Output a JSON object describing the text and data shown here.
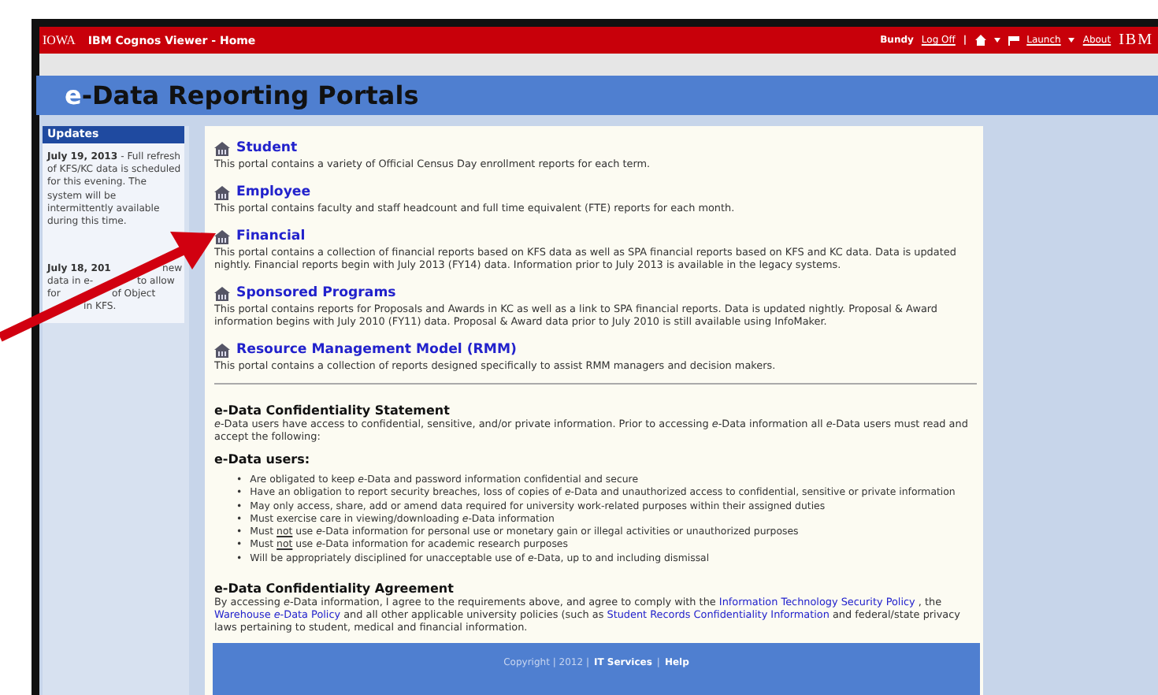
{
  "header": {
    "logo": "IOWA",
    "title": "IBM Cognos Viewer - Home",
    "user": "Bundy",
    "log_off": "Log Off",
    "separator": "|",
    "launch": "Launch",
    "about": "About",
    "brand": "IBM"
  },
  "page_title": {
    "prefix": "e",
    "text": "-Data Reporting Portals"
  },
  "updates": {
    "title": "Updates",
    "notes": [
      {
        "kind": "full",
        "date": "July 19, 2013",
        "text": " - Full refresh of KFS/KC data is scheduled for this evening. The system will be intermittently available during this time."
      },
      {
        "kind": "fragments",
        "lines": [
          [
            "July 18, 201",
            "new"
          ],
          [
            "data in e-",
            "to allow"
          ],
          [
            "for",
            "of Object"
          ],
          [
            "in KFS."
          ]
        ]
      }
    ]
  },
  "portals": [
    {
      "title": "Student",
      "description": "This portal contains a variety of Official Census Day enrollment reports for each term."
    },
    {
      "title": "Employee",
      "description": "This portal contains faculty and staff headcount and full time equivalent (FTE) reports for each month."
    },
    {
      "title": "Financial",
      "description": "This portal contains a collection of financial reports based on KFS data as well as SPA financial reports based on KFS and KC data. Data is updated nightly. Financial reports begin with July 2013 (FY14) data. Information prior to July 2013 is available in the legacy systems."
    },
    {
      "title": "Sponsored Programs",
      "description": "This portal contains reports for Proposals and Awards in KC as well as a link to SPA financial reports. Data is updated nightly. Proposal & Award information begins with July 2010 (FY11) data. Proposal & Award data prior to July 2010 is still available using InfoMaker."
    },
    {
      "title": "Resource Management Model (RMM)",
      "description": "This portal contains a collection of reports designed specifically to assist RMM managers and decision makers."
    }
  ],
  "statement": {
    "title": "e-Data Confidentiality Statement",
    "text": "*e*-Data users have access to confidential, sensitive, and/or private information. Prior to accessing *e*-Data information all *e*-Data users must read and accept the following:"
  },
  "users": {
    "title": "e-Data users:",
    "marker": "•",
    "bullets": [
      [
        {
          "text": "Are obligated to keep *e*-Data and password information confidential and secure"
        }
      ],
      [
        {
          "text": "Have an obligation to report security breaches, loss of copies of *e*-Data and unauthorized access to confidential, sensitive or private information"
        }
      ],
      [
        {
          "text": "May only access, share, add or amend data required for university work-related purposes within their assigned duties"
        }
      ],
      [
        {
          "text": "Must exercise care in viewing/downloading *e*-Data information"
        }
      ],
      [
        {
          "text": "Must "
        },
        {
          "text": "not",
          "underline": true
        },
        {
          "text": " use *e*-Data information for personal use or monetary gain or illegal activities or unauthorized purposes"
        }
      ],
      [
        {
          "text": "Must "
        },
        {
          "text": "not",
          "underline": true
        },
        {
          "text": " use *e*-Data information for academic research purposes"
        }
      ],
      [
        {
          "text": "Will be appropriately disciplined for unacceptable use of *e*-Data, up to and including dismissal"
        }
      ]
    ]
  },
  "agreement": {
    "title": "e-Data Confidentiality Agreement",
    "parts": [
      {
        "kind": "text",
        "text": "By accessing *e*-Data information, I agree to the requirements above, and agree to comply with the "
      },
      {
        "kind": "link",
        "text": "Information Technology Security Policy"
      },
      {
        "kind": "text",
        "text": " , the "
      },
      {
        "kind": "link",
        "text": "Warehouse *e*-Data Policy"
      },
      {
        "kind": "text",
        "text": " and all other applicable university policies (such as "
      },
      {
        "kind": "link",
        "text": "Student Records Confidentiality Information"
      },
      {
        "kind": "text",
        "text": " and federal/state privacy laws pertaining to student, medical and financial information."
      }
    ]
  },
  "footer": {
    "parts": [
      {
        "kind": "text",
        "text": "Copyright | 2012 |"
      },
      {
        "kind": "link",
        "text": "IT Services"
      },
      {
        "kind": "text",
        "text": "|"
      },
      {
        "kind": "link",
        "text": "Help"
      }
    ]
  }
}
